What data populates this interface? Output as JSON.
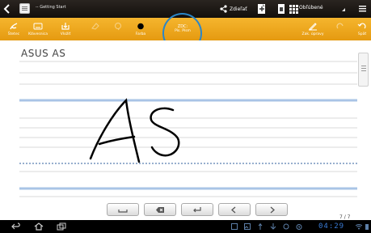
{
  "topbar": {
    "notebook_title": "-- Getting Start",
    "share_label": "Zdieľať",
    "favorites_label": "Obľúbené"
  },
  "toolbar": {
    "tools": [
      {
        "label": "Štetec"
      },
      {
        "label": "Klávesnica"
      },
      {
        "label": "Vložiť"
      },
      {
        "label": ""
      },
      {
        "label": ""
      },
      {
        "label": "Farba"
      }
    ],
    "text_mode_top": "ZDC:",
    "text_mode_bottom": "Pís. Písm",
    "right_tools": [
      {
        "label": "Zak. úpravy"
      },
      {
        "label": ""
      },
      {
        "label": "Späť"
      }
    ]
  },
  "page": {
    "title": "ASUS AS",
    "handwriting": "AS",
    "page_number": "7 / 7"
  },
  "system": {
    "clock": "04:29"
  },
  "colors": {
    "accent": "#2a86c8",
    "toolbar_orange": "#f0a820",
    "line_blue": "#a9c4e6",
    "baseline_blue": "#2f5f9e"
  }
}
